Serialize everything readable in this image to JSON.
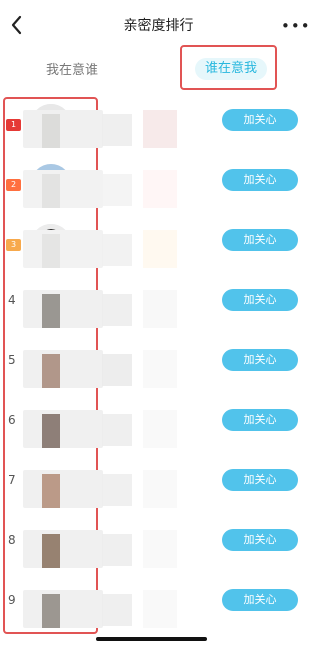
{
  "header": {
    "title": "亲密度排行",
    "more": "•••"
  },
  "tabs": {
    "left": "我在意谁",
    "right": "谁在意我"
  },
  "ranks": [
    {
      "rank": "1",
      "button": "加关心"
    },
    {
      "rank": "2",
      "button": "加关心"
    },
    {
      "rank": "3",
      "button": "加关心"
    },
    {
      "rank": "4",
      "button": "加关心"
    },
    {
      "rank": "5",
      "button": "加关心"
    },
    {
      "rank": "6",
      "button": "加关心"
    },
    {
      "rank": "7",
      "button": "加关心"
    },
    {
      "rank": "8",
      "button": "加关心"
    },
    {
      "rank": "9",
      "button": "加关心"
    }
  ],
  "colors": {
    "accent": "#51c3eb",
    "highlight": "#e15454"
  },
  "icons": {
    "back": "chevron-left-icon",
    "more": "more-icon"
  }
}
